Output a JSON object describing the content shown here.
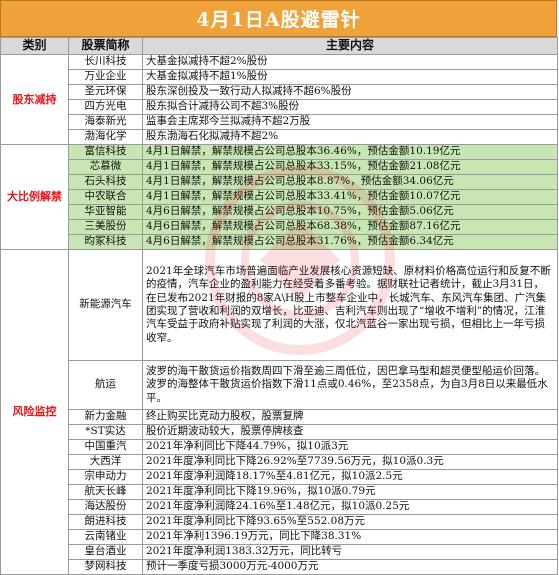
{
  "title": "4月1日A股避雷针",
  "header": {
    "col1": "类别",
    "col2": "股票简称",
    "col3": "主要内容"
  },
  "sections": [
    {
      "category": "股东减持",
      "rows": [
        {
          "name": "长川科技",
          "content": "大基金拟减持不超2%股份"
        },
        {
          "name": "万业企业",
          "content": "大基金拟减持不超1%股份"
        },
        {
          "name": "圣元环保",
          "content": "股东深创投及一致行动人拟减持不超6%股份"
        },
        {
          "name": "四方光电",
          "content": "股东拟合计减持公司不超3%股份"
        },
        {
          "name": "海泰新光",
          "content": "监事会主席郑今兰拟减持不超2万股"
        },
        {
          "name": "渤海化学",
          "content": "股东渤海石化拟减持不超2%"
        }
      ]
    },
    {
      "category": "大比例解禁",
      "rows": [
        {
          "name": "富信科技",
          "content": "4月1日解禁，解禁规模占公司总股本36.46%，预估金额10.19亿元"
        },
        {
          "name": "芯慕微",
          "content": "4月1日解禁，解禁规模占公司总股本33.15%，预估金额21.08亿元"
        },
        {
          "name": "石头科技",
          "content": "4月1日解禁，解禁规模占公司总股本8.87%，预估金额34.06亿元"
        },
        {
          "name": "中农联合",
          "content": "4月1日解禁，解禁规模占公司总股本33.41%，预估金额10.07亿元"
        },
        {
          "name": "华亚智能",
          "content": "4月6日解禁，解禁规模占公司总股本10.75%，预估金额5.06亿元"
        },
        {
          "name": "三美股份",
          "content": "4月6日解禁，解禁规模占公司总股本68.38%，预估金额87.16亿元"
        },
        {
          "name": "昀冢科技",
          "content": "4月6日解禁，解禁规模占公司总股本31.76%，预估金额6.34亿元"
        }
      ]
    },
    {
      "category": "风险监控",
      "rows": [
        {
          "name": "新能源汽车",
          "content": "2021年全球汽车市场普遍面临产业发展核心资源短缺、原材料价格高位运行和反复不断的疫情，汽车企业的盈利能力在经受着多番考验。据财联社记者统计，截止3月31日，在已发布2021年财报的8家A\\H股上市整车企业中，长城汽车、东风汽车集团、广汽集团实现了营收和利润的双增长，比亚迪、吉利汽车则出现了“增收不增利”的情况，江淮汽车受益于政府补贴实现了利润的大涨，仅北汽蓝谷一家出现亏损，但相比上一年亏损收窄。"
        },
        {
          "name": "航运",
          "content": "波罗的海干散货运价指数周四下滑至逾三周低位，因巴拿马型和超灵便型船运价回落。波罗的海整体干散货运价指数下滑11点或0.46%，至2358点，为自3月8日以来最低水平。"
        },
        {
          "name": "新力金融",
          "content": "终止购买比克动力股权，股票复牌"
        },
        {
          "name": "*ST实达",
          "content": "股价近期波动较大，股票停牌核查"
        },
        {
          "name": "中国重汽",
          "content": "2021年净利同比下降44.79%，拟10派3元"
        },
        {
          "name": "大西洋",
          "content": "2021年度净利同比下降26.92%至7739.56万元，拟10派0.3元"
        },
        {
          "name": "宗申动力",
          "content": "2021年度净利润降18.17%至4.81亿元，拟10派2.5元"
        },
        {
          "name": "航天长峰",
          "content": "2021年度净利同比下降19.96%，拟10派0.79元"
        },
        {
          "name": "海达股份",
          "content": "2021年度净利润降24.16%至1.48亿元，拟10派0.25元"
        },
        {
          "name": "朗进科技",
          "content": "2021年度净利同比下降93.65%至552.08万元"
        },
        {
          "name": "云南锗业",
          "content": "2021年净利1396.19万元，同比下降38.31%"
        },
        {
          "name": "皇台酒业",
          "content": "2021年度净利润1383.32万元，同比转亏"
        },
        {
          "name": "梦网科技",
          "content": "预计一季度亏损3000万元-4000万元"
        }
      ]
    }
  ],
  "colors": {
    "banner": "#f0a23a",
    "category_text": "#e8141c",
    "highlight": "#c8e6b4"
  }
}
